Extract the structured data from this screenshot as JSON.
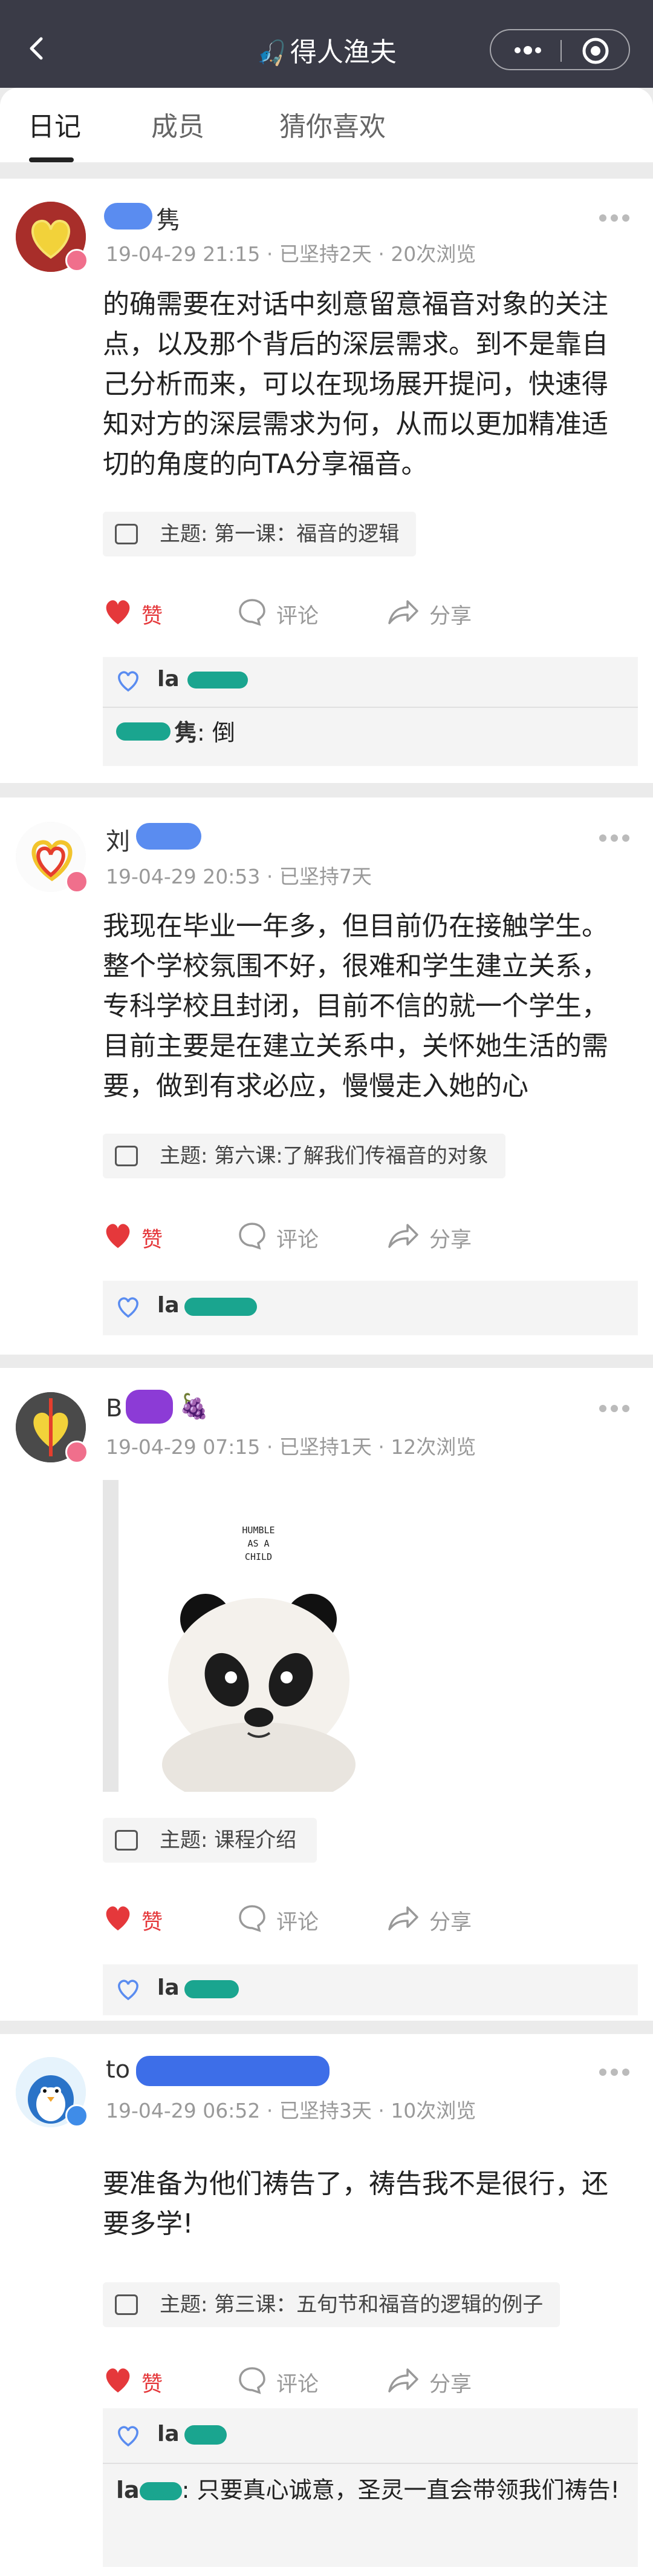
{
  "header": {
    "title": "得人渔夫",
    "title_emoji": "🎣"
  },
  "tabs": [
    {
      "label": "日记",
      "active": true
    },
    {
      "label": "成员",
      "active": false
    },
    {
      "label": "猜你喜欢",
      "active": false
    }
  ],
  "colors": {
    "header_bg": "#3a3b47",
    "like_red": "#e5383b",
    "name_blur_blue": "#5a8cf0",
    "name_blur_teal": "#1aa58f",
    "name_blur_purple": "#8c3bd6"
  },
  "posts": [
    {
      "name_visible": "隽",
      "meta": "19-04-29 21:15  ·  已坚持2天  ·  20次浏览",
      "content": "的确需要在对话中刻意留意福音对象的关注点，以及那个背后的深层需求。到不是靠自己分析而来，可以在现场展开提问，快速得知对方的深层需求为何，从而以更加精准适切的角度的向TA分享福音。",
      "topic": "主题: 第一课：福音的逻辑",
      "actions": {
        "like": "赞",
        "comment": "评论",
        "share": "分享"
      },
      "likes": "la",
      "comments": [
        {
          "name": "隽",
          "text": "倒"
        }
      ]
    },
    {
      "name_visible": "刘",
      "meta": "19-04-29 20:53  ·  已坚持7天",
      "content": "我现在毕业一年多，但目前仍在接触学生。整个学校氛围不好，很难和学生建立关系，专科学校且封闭，目前不信的就一个学生，目前主要是在建立关系中，关怀她生活的需要，做到有求必应，慢慢走入她的心",
      "topic": "主题: 第六课:了解我们传福音的对象",
      "actions": {
        "like": "赞",
        "comment": "评论",
        "share": "分享"
      },
      "likes": "la"
    },
    {
      "name_visible": "B",
      "name_emoji": "🍇",
      "meta": "19-04-29 07:15  ·  已坚持1天  ·  12次浏览",
      "photo_text": [
        "HUMBLE",
        "AS A",
        "CHILD"
      ],
      "topic": "主题: 课程介绍",
      "actions": {
        "like": "赞",
        "comment": "评论",
        "share": "分享"
      },
      "likes": "la"
    },
    {
      "name_visible": "to",
      "meta": "19-04-29 06:52  ·  已坚持3天  ·  10次浏览",
      "content": "要准备为他们祷告了，祷告我不是很行，还要多学!",
      "topic": "主题: 第三课：五旬节和福音的逻辑的例子",
      "actions": {
        "like": "赞",
        "comment": "评论",
        "share": "分享"
      },
      "likes": "la",
      "comments": [
        {
          "name": "la",
          "text": "只要真心诚意，圣灵一直会带领我们祷告!"
        }
      ]
    }
  ]
}
